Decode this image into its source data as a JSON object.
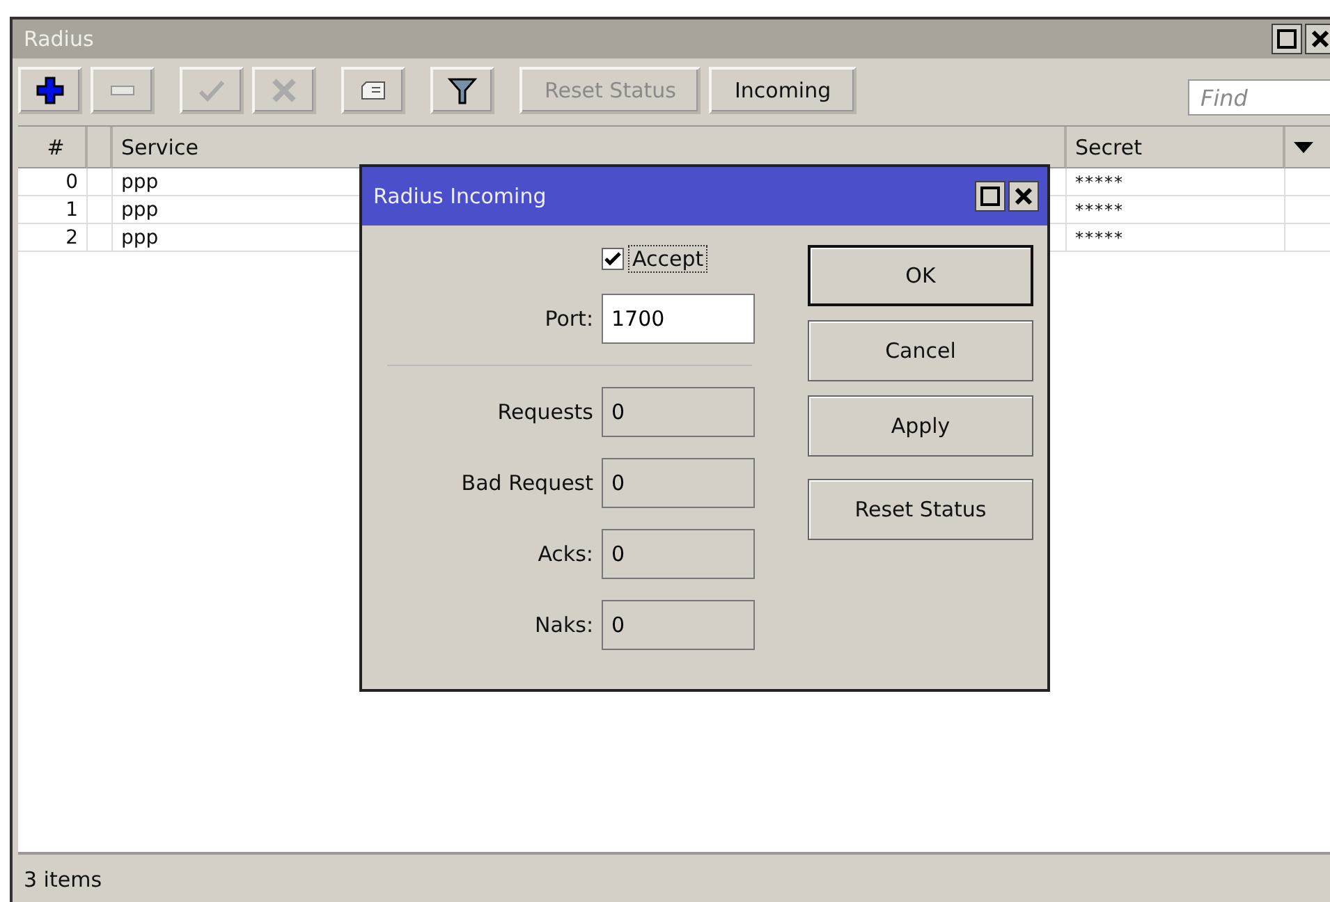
{
  "window": {
    "title": "Radius"
  },
  "toolbar": [
    {
      "kind": "add",
      "disabled": false
    },
    {
      "kind": "remove",
      "disabled": true
    },
    {
      "kind": "enable",
      "disabled": true
    },
    {
      "kind": "disable",
      "disabled": true
    },
    {
      "kind": "comment",
      "disabled": false
    },
    {
      "kind": "filter",
      "disabled": false
    },
    {
      "kind": "text",
      "label": "Reset Status",
      "disabled": true
    },
    {
      "kind": "text",
      "label": "Incoming",
      "disabled": false
    }
  ],
  "search": {
    "placeholder": "Find"
  },
  "table": {
    "columns": [
      "#",
      "Service",
      "Secret"
    ],
    "rows": [
      {
        "number": "0",
        "service": "ppp",
        "secret": "*****"
      },
      {
        "number": "1",
        "service": "ppp",
        "secret": "*****"
      },
      {
        "number": "2",
        "service": "ppp",
        "secret": "*****"
      }
    ]
  },
  "status_bar": "3 items",
  "dialog": {
    "title": "Radius Incoming",
    "accept": {
      "label": "Accept",
      "checked": true
    },
    "port": {
      "label": "Port:",
      "value": "1700"
    },
    "stats": [
      {
        "label": "Requests",
        "value": "0"
      },
      {
        "label": "Bad Request",
        "value": "0"
      },
      {
        "label": "Acks:",
        "value": "0"
      },
      {
        "label": "Naks:",
        "value": "0"
      }
    ],
    "buttons": [
      {
        "label": "OK",
        "default": true
      },
      {
        "label": "Cancel",
        "default": false
      },
      {
        "label": "Apply",
        "default": false
      },
      {
        "label": "Reset Status",
        "default": false
      }
    ]
  }
}
